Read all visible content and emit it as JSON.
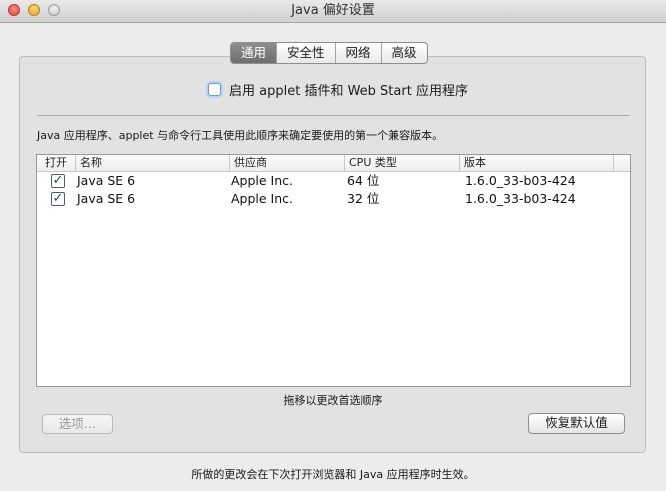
{
  "window": {
    "title": "Java 偏好设置"
  },
  "tabs": [
    {
      "label": "通用",
      "active": true
    },
    {
      "label": "安全性",
      "active": false
    },
    {
      "label": "网络",
      "active": false
    },
    {
      "label": "高级",
      "active": false
    }
  ],
  "general": {
    "enable_checkbox_label": "启用 applet 插件和 Web Start 应用程序",
    "enable_checked": false,
    "description": "Java 应用程序、applet 与命令行工具使用此顺序来确定要使用的第一个兼容版本。",
    "table": {
      "headers": [
        "打开",
        "名称",
        "供应商",
        "CPU 类型",
        "版本"
      ],
      "rows": [
        {
          "enabled": true,
          "name": "Java SE 6",
          "vendor": "Apple Inc.",
          "cpu": "64 位",
          "version": "1.6.0_33-b03-424"
        },
        {
          "enabled": true,
          "name": "Java SE 6",
          "vendor": "Apple Inc.",
          "cpu": "32 位",
          "version": "1.6.0_33-b03-424"
        }
      ]
    },
    "drag_hint": "拖移以更改首选顺序",
    "options_button": "选项…",
    "restore_button": "恢复默认值"
  },
  "footer": "所做的更改会在下次打开浏览器和 Java 应用程序时生效。"
}
